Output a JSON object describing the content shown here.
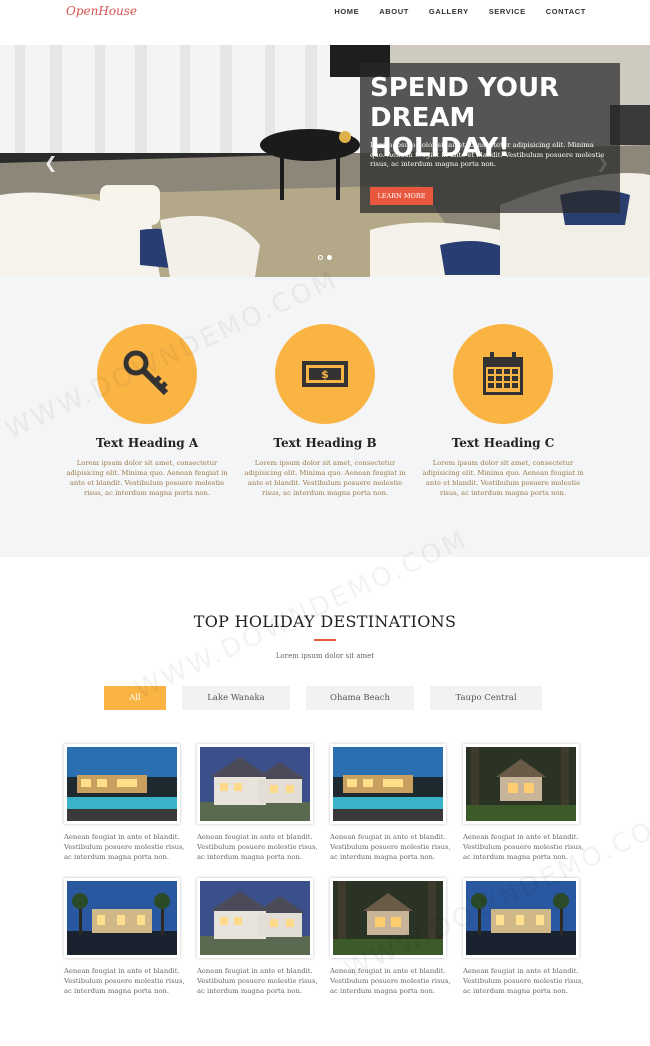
{
  "nav": {
    "logo": "OpenHouse",
    "items": [
      "HOME",
      "ABOUT",
      "GALLERY",
      "SERVICE",
      "CONTACT"
    ]
  },
  "hero": {
    "title": "SPEND YOUR DREAM HOLIDAY!",
    "text": "Lorem ipsum dolor sit amet, consectetur adipisicing elit. Minima quo. Aenean feugiat in ante et blandit. Vestibulum posuere molestie risus, ac interdum magna porta non.",
    "button": "LEARN MORE",
    "prev_icon": "chevron-left-icon",
    "next_icon": "chevron-right-icon",
    "slides_total": 2,
    "active_slide": 2
  },
  "features": [
    {
      "icon": "key-icon",
      "heading": "Text Heading A",
      "text": "Lorem ipsum dolor sit amet, consectetur adipisicing elit. Minima quo. Aenean feugiat in ante et blandit. Vestibulum posuere molestie risus, ac interdum magna porta non."
    },
    {
      "icon": "money-icon",
      "heading": "Text Heading B",
      "text": "Lorem ipsum dolor sit amet, consectetur adipisicing elit. Minima quo. Aenean feugiat in ante et blandit. Vestibulum posuere molestie risus, ac interdum magna porta non."
    },
    {
      "icon": "calendar-icon",
      "heading": "Text Heading C",
      "text": "Lorem ipsum dolor sit amet, consectetur adipisicing elit. Minima quo. Aenean feugiat in ante et blandit. Vestibulum posuere molestie risus, ac interdum magna porta non."
    }
  ],
  "destinations": {
    "title": "TOP HOLIDAY DESTINATIONS",
    "subtitle": "Lorem ipsum dolor sit amet",
    "filters": [
      "All",
      "Lake Wanaka",
      "Ohama Beach",
      "Taupo Central"
    ],
    "active_filter": "All",
    "cards": [
      {
        "caption": "Aenean feugiat in ante et blandit. Vestibulum posuere molestie risus, ac interdum magna porta non."
      },
      {
        "caption": "Aenean feugiat in ante et blandit. Vestibulum posuere molestie risus, ac interdum magna porta non."
      },
      {
        "caption": "Aenean feugiat in ante et blandit. Vestibulum posuere molestie risus, ac interdum magna porta non."
      },
      {
        "caption": "Aenean feugiat in ante et blandit. Vestibulum posuere molestie risus, ac interdum magna porta non."
      },
      {
        "caption": "Aenean feugiat in ante et blandit. Vestibulum posuere molestie risus, ac interdum magna porta non."
      },
      {
        "caption": "Aenean feugiat in ante et blandit. Vestibulum posuere molestie risus, ac interdum magna porta non."
      },
      {
        "caption": "Aenean feugiat in ante et blandit. Vestibulum posuere molestie risus, ac interdum magna porta non."
      },
      {
        "caption": "Aenean feugiat in ante et blandit. Vestibulum posuere molestie risus, ac interdum magna porta non."
      }
    ]
  },
  "watermark": "WWW.DOWNDEMO.COM",
  "colors": {
    "accent": "#e9573f",
    "feature_circle": "#f9b444",
    "logo": "#d9534f"
  }
}
